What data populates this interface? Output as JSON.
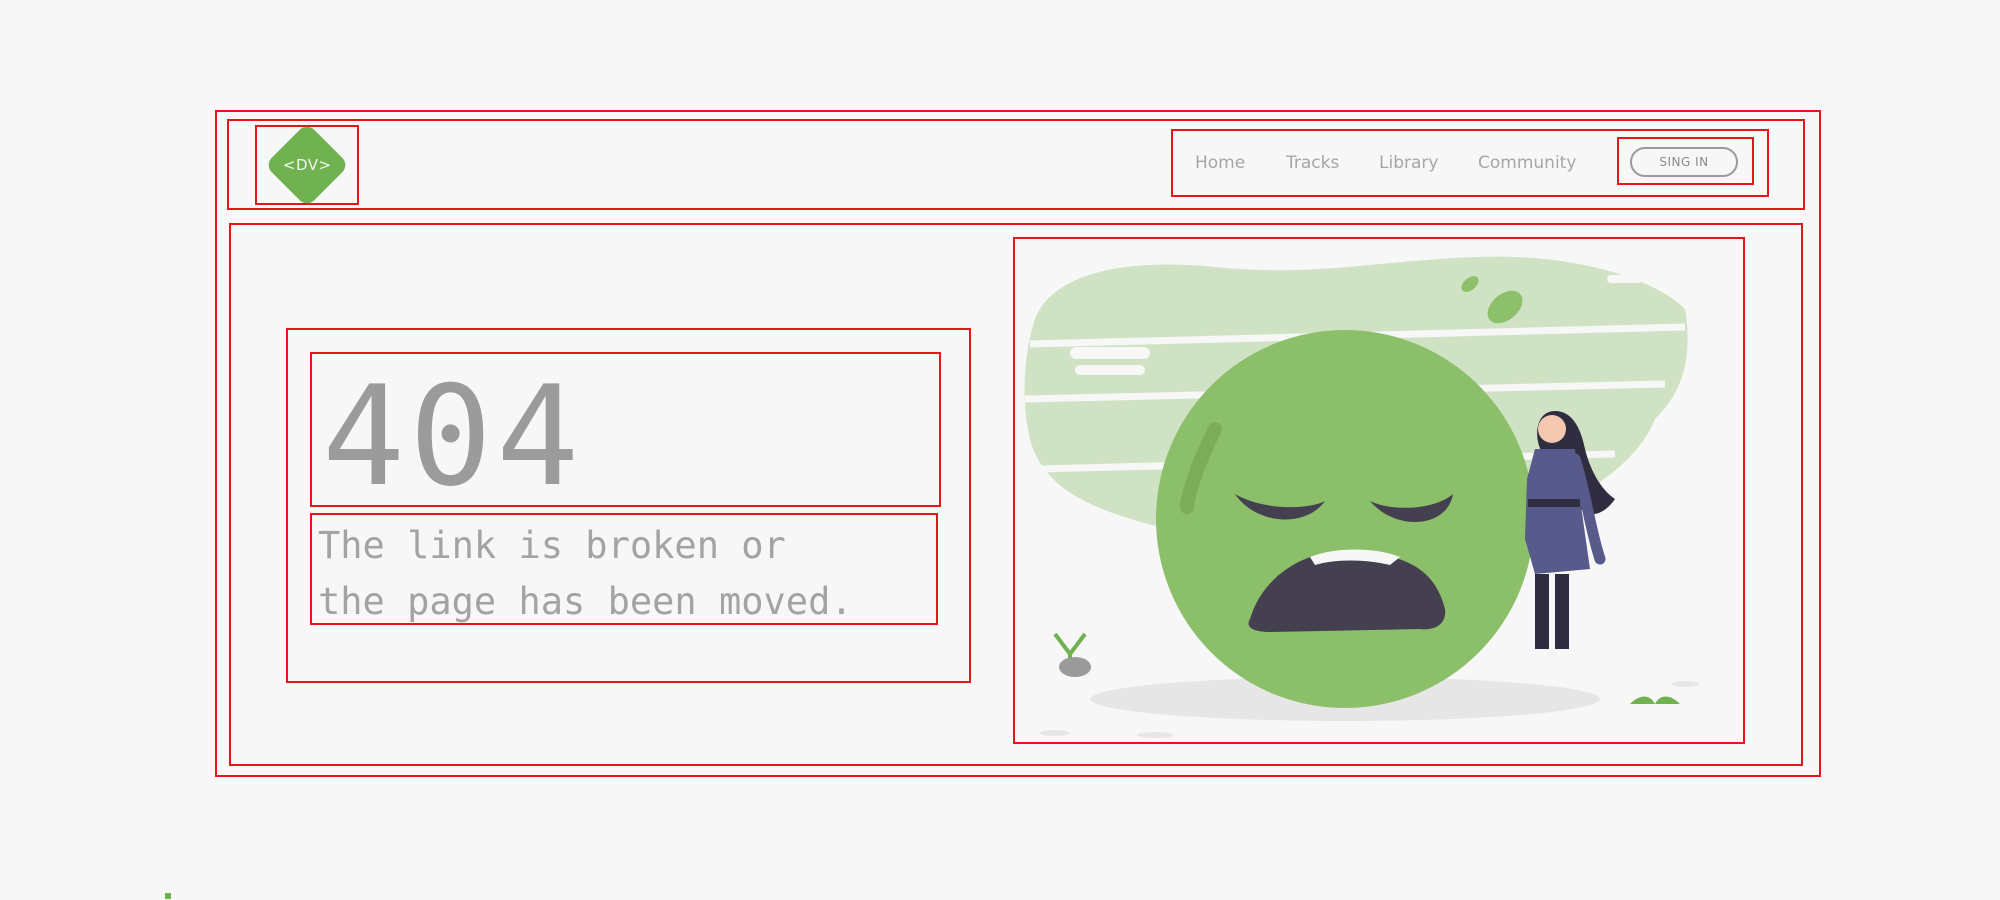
{
  "header": {
    "logo_text": "<DV>",
    "nav": {
      "home": "Home",
      "tracks": "Tracks",
      "library": "Library",
      "community": "Community"
    },
    "signin_label": "SING IN"
  },
  "main": {
    "code": "404",
    "message_line1": "The link is broken or",
    "message_line2": "the page has been moved."
  },
  "colors": {
    "accent": "#6fb24f",
    "accent_light": "#cfe3c4",
    "outline": "#e8141d",
    "mouth": "#45404f",
    "dress": "#575a8a"
  },
  "icons": [
    "logo-diamond-icon",
    "sad-face-illustration"
  ]
}
